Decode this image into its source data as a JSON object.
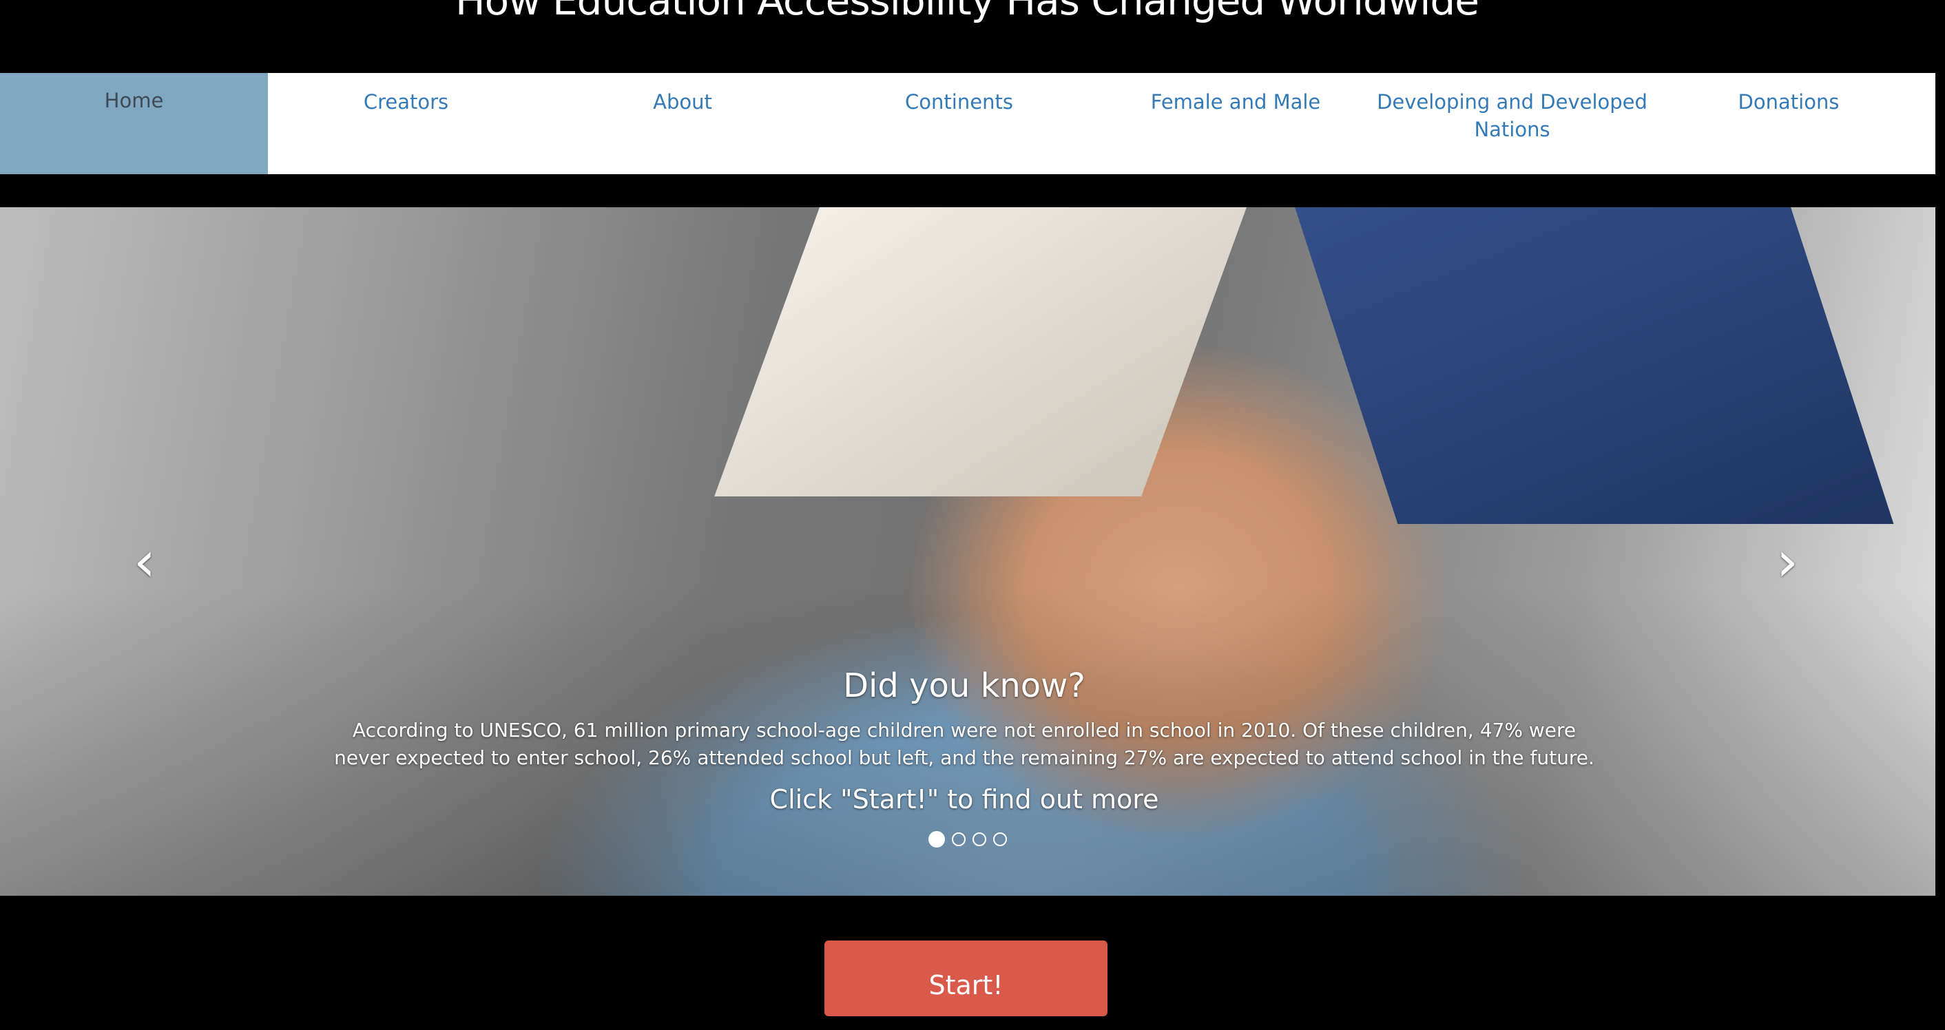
{
  "page": {
    "title": "How Education Accessibility Has Changed Worldwide"
  },
  "nav": {
    "items": [
      {
        "label": "Home",
        "active": true
      },
      {
        "label": "Creators"
      },
      {
        "label": "About"
      },
      {
        "label": "Continents"
      },
      {
        "label": "Female and Male"
      },
      {
        "label": "Developing and Developed Nations"
      },
      {
        "label": "Donations"
      }
    ]
  },
  "carousel": {
    "prev_icon": "chevron-left-icon",
    "next_icon": "chevron-right-icon",
    "caption": {
      "heading": "Did you know?",
      "body": "According to UNESCO, 61 million primary school-age children were not enrolled in school in 2010. Of these children, 47% were never expected to enter school, 26% attended school but left, and the remaining 27% are expected to attend school in the future.",
      "cta": "Click \"Start!\" to find out more"
    },
    "indicator_count": 4,
    "active_index": 0
  },
  "start_button": {
    "label": "Start!"
  },
  "colors": {
    "nav_active_bg": "#81a8c2",
    "nav_link": "#337ab7",
    "start_button": "#d9594a",
    "page_bg": "#000000"
  }
}
